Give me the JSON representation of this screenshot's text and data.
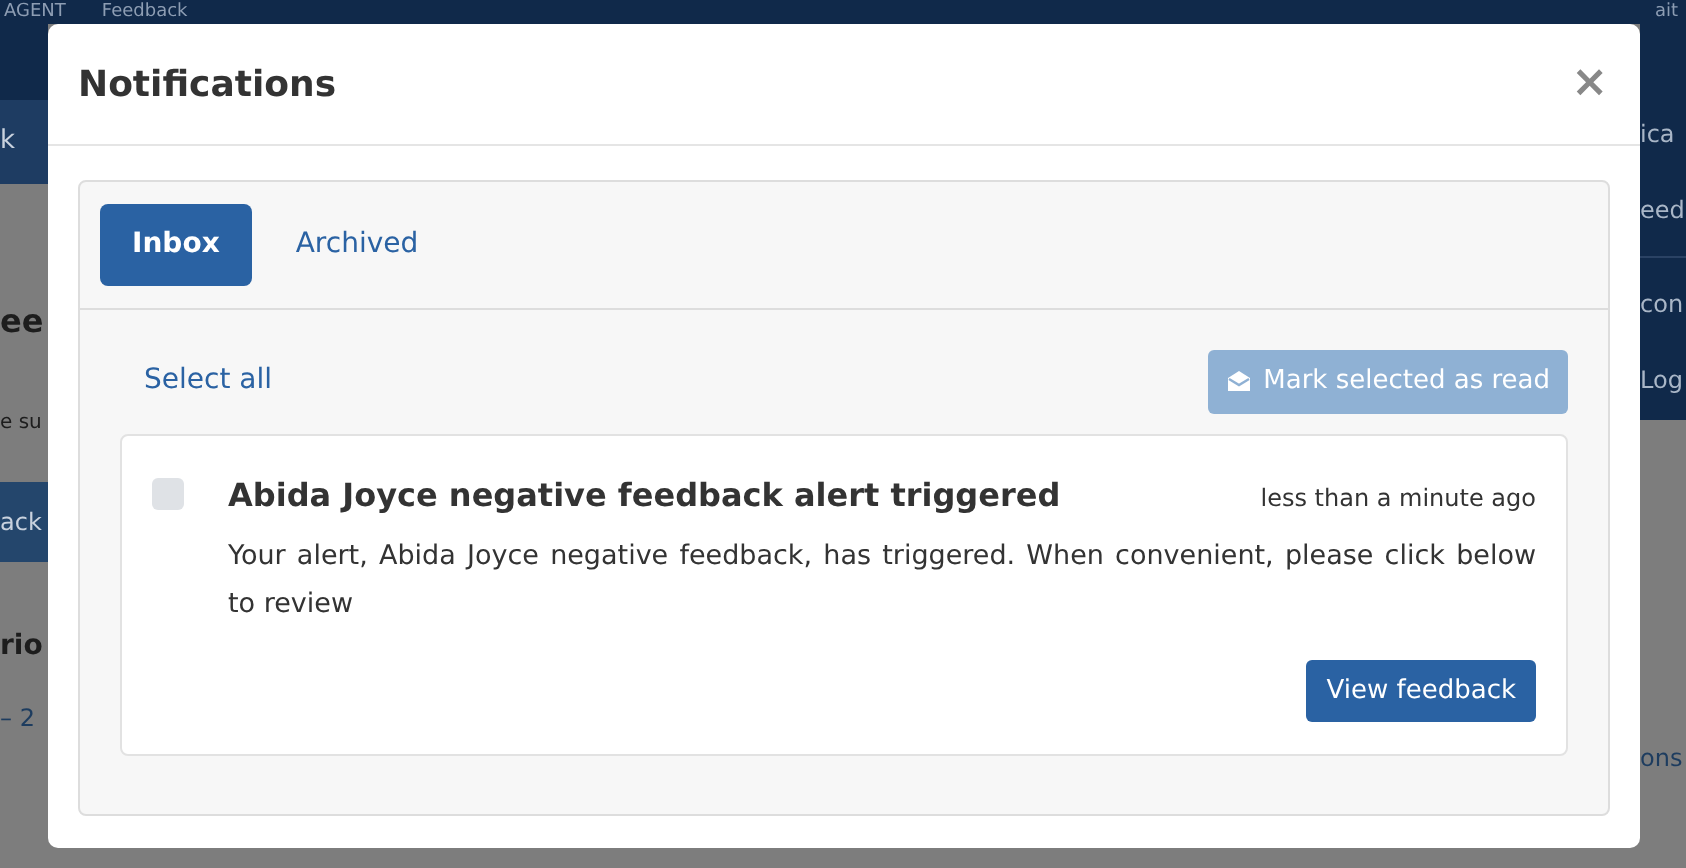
{
  "background": {
    "brand": "AGENT",
    "nav_item": "Feedback",
    "nav_right": "ait",
    "left_fragments": [
      {
        "kind": "tab",
        "text": "k"
      },
      {
        "kind": "heading",
        "text": "ee"
      },
      {
        "kind": "text",
        "text": "e su"
      },
      {
        "kind": "button",
        "text": "ack"
      },
      {
        "kind": "subheading",
        "text": "rio"
      },
      {
        "kind": "link",
        "text": "– 2"
      }
    ],
    "right_menu": [
      {
        "kind": "item",
        "text": "ica"
      },
      {
        "kind": "item",
        "text": "eed"
      },
      {
        "kind": "item",
        "text": "con"
      },
      {
        "kind": "item",
        "text": "Log"
      }
    ],
    "right_fragments": [
      {
        "kind": "link",
        "text": "ons"
      }
    ]
  },
  "modal": {
    "title": "Notifications",
    "close": "×",
    "tabs": [
      {
        "label": "Inbox",
        "selected": true
      },
      {
        "label": "Archived",
        "selected": false
      }
    ],
    "select_all": "Select all",
    "mark_read": {
      "label": "Mark selected as read",
      "disabled": true
    },
    "notifications": [
      {
        "title": "Abida Joyce negative feedback alert triggered",
        "time": "less than a minute ago",
        "message": "Your alert, Abida Joyce negative feedback, has triggered. When convenient, please click below to review",
        "checked": false,
        "action": "View feedback"
      }
    ]
  }
}
